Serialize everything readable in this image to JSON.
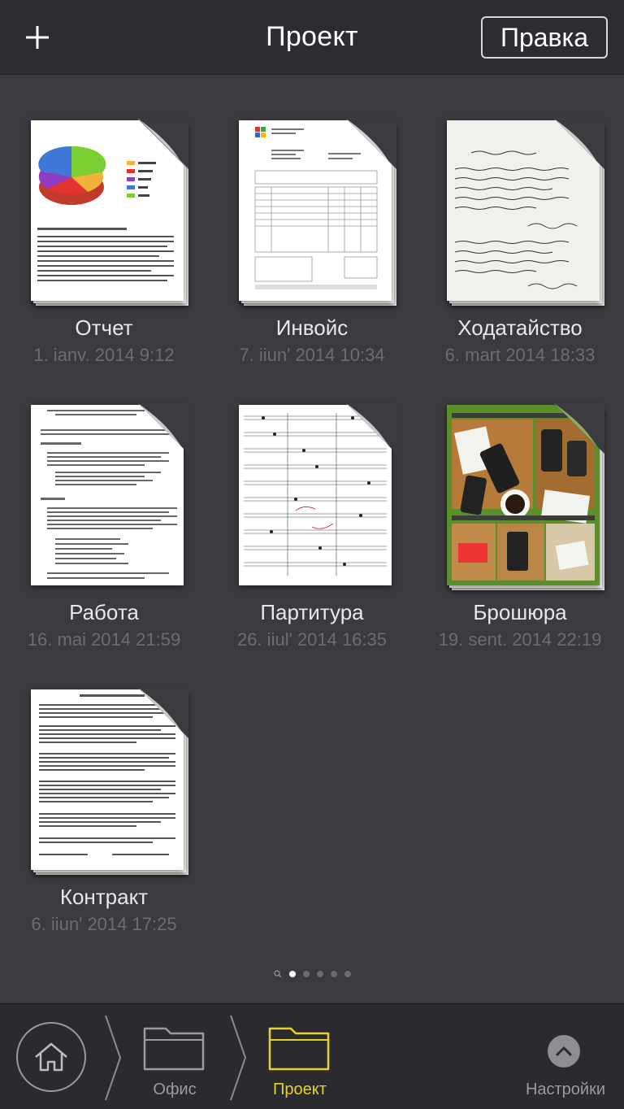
{
  "navbar": {
    "add_icon": "plus-icon",
    "title": "Проект",
    "edit_label": "Правка"
  },
  "documents": [
    {
      "name": "Отчет",
      "date": "1. ianv. 2014 9:12",
      "thumbnail": "pie-chart-report"
    },
    {
      "name": "Инвойс",
      "date": "7. iiun' 2014 10:34",
      "thumbnail": "invoice-table"
    },
    {
      "name": "Ходатайство",
      "date": "6. mart 2014 18:33",
      "thumbnail": "handwritten-letter"
    },
    {
      "name": "Работа",
      "date": "16. mai 2014 21:59",
      "thumbnail": "text-document"
    },
    {
      "name": "Партитура",
      "date": "26. iiul' 2014 16:35",
      "thumbnail": "music-score"
    },
    {
      "name": "Брошюра",
      "date": "19. sent. 2014 22:19",
      "thumbnail": "photo-brochure"
    },
    {
      "name": "Контракт",
      "date": "6. iiun' 2014 17:25",
      "thumbnail": "contract-text"
    }
  ],
  "pagination": {
    "total": 6,
    "current": 1,
    "first_is_search": true
  },
  "toolbar": {
    "home_icon": "home-icon",
    "breadcrumbs": [
      {
        "label": "Офис",
        "active": false
      },
      {
        "label": "Проект",
        "active": true
      }
    ],
    "settings_label": "Настройки",
    "active_color": "#e6d32a",
    "inactive_color": "#9c9ca0"
  }
}
